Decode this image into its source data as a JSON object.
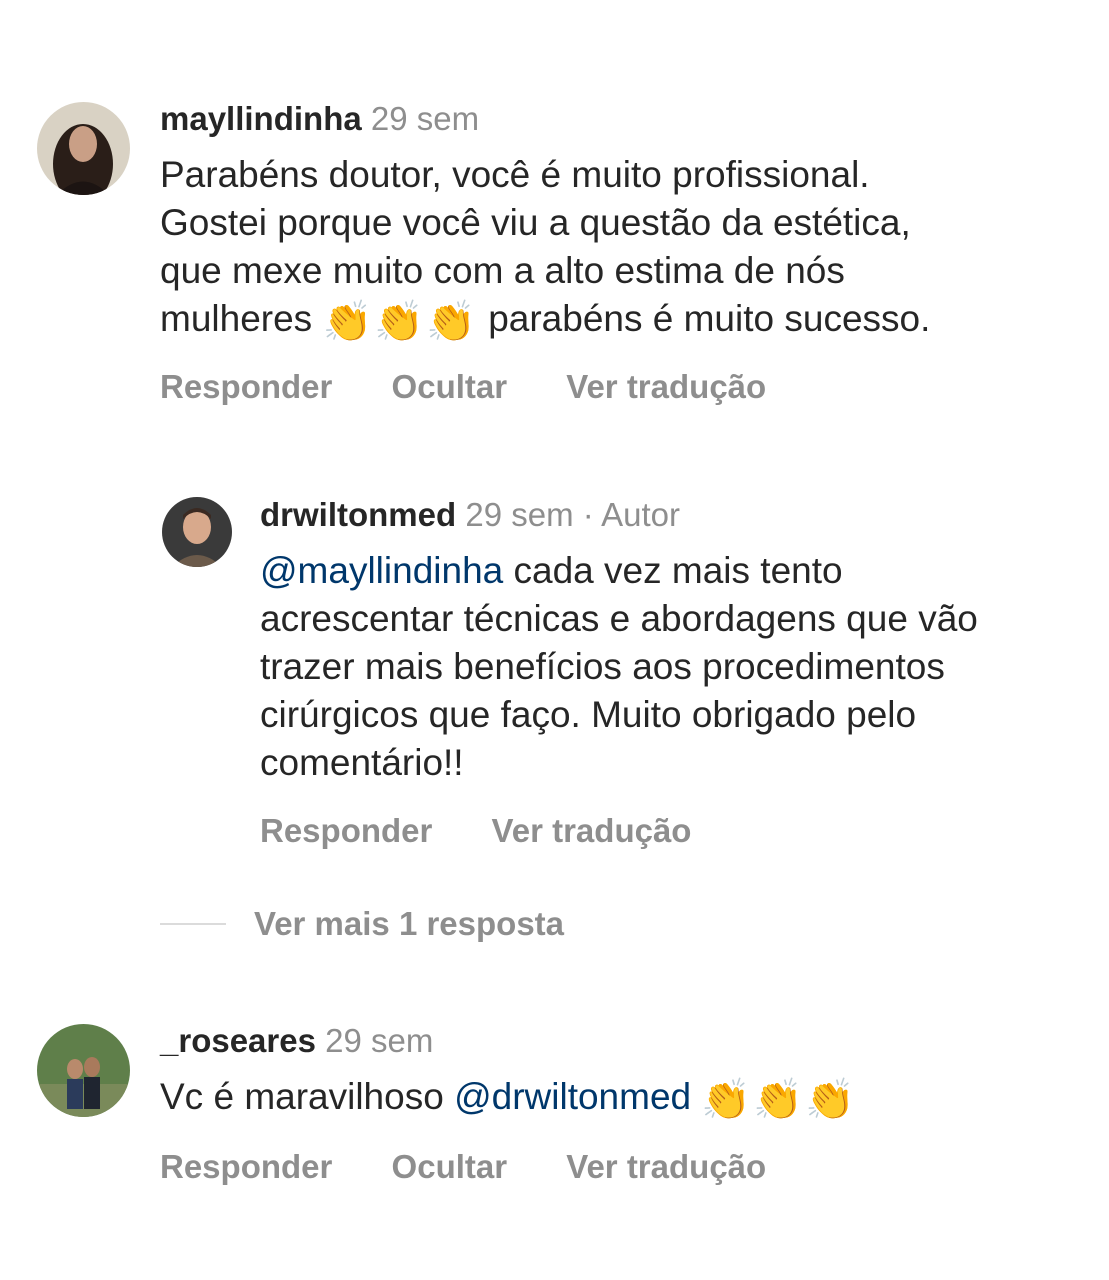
{
  "comments": [
    {
      "username": "mayllindinha",
      "time": "29 sem",
      "lines": [
        "Parabéns doutor, você é muito profissional.",
        "Gostei porque você viu a questão da estética,",
        "que mexe muito com a alto estima de nós"
      ],
      "last_line_before": "mulheres",
      "last_line_after": "parabéns é muito sucesso.",
      "emoji": "👏",
      "actions": {
        "reply": "Responder",
        "hide": "Ocultar",
        "translate": "Ver tradução"
      }
    },
    {
      "username": "drwiltonmed",
      "time": "29 sem",
      "separator": "·",
      "author_badge": "Autor",
      "mention": "@mayllindinha",
      "first_line_rest": "cada vez mais tento",
      "lines": [
        "acrescentar técnicas e abordagens que vão",
        "trazer mais benefícios aos procedimentos",
        "cirúrgicos que faço. Muito obrigado pelo",
        "comentário!!"
      ],
      "actions": {
        "reply": "Responder",
        "translate": "Ver tradução"
      }
    },
    {
      "username": "_roseares",
      "time": "29 sem",
      "text_before": "Vc é maravilhoso",
      "mention": "@drwiltonmed",
      "emoji": "👏",
      "actions": {
        "reply": "Responder",
        "hide": "Ocultar",
        "translate": "Ver tradução"
      }
    }
  ],
  "more_replies": "Ver mais 1 resposta",
  "colors": {
    "text": "#262626",
    "secondary": "#8e8e8e",
    "mention": "#00376b",
    "divider": "#dbdbdb"
  }
}
